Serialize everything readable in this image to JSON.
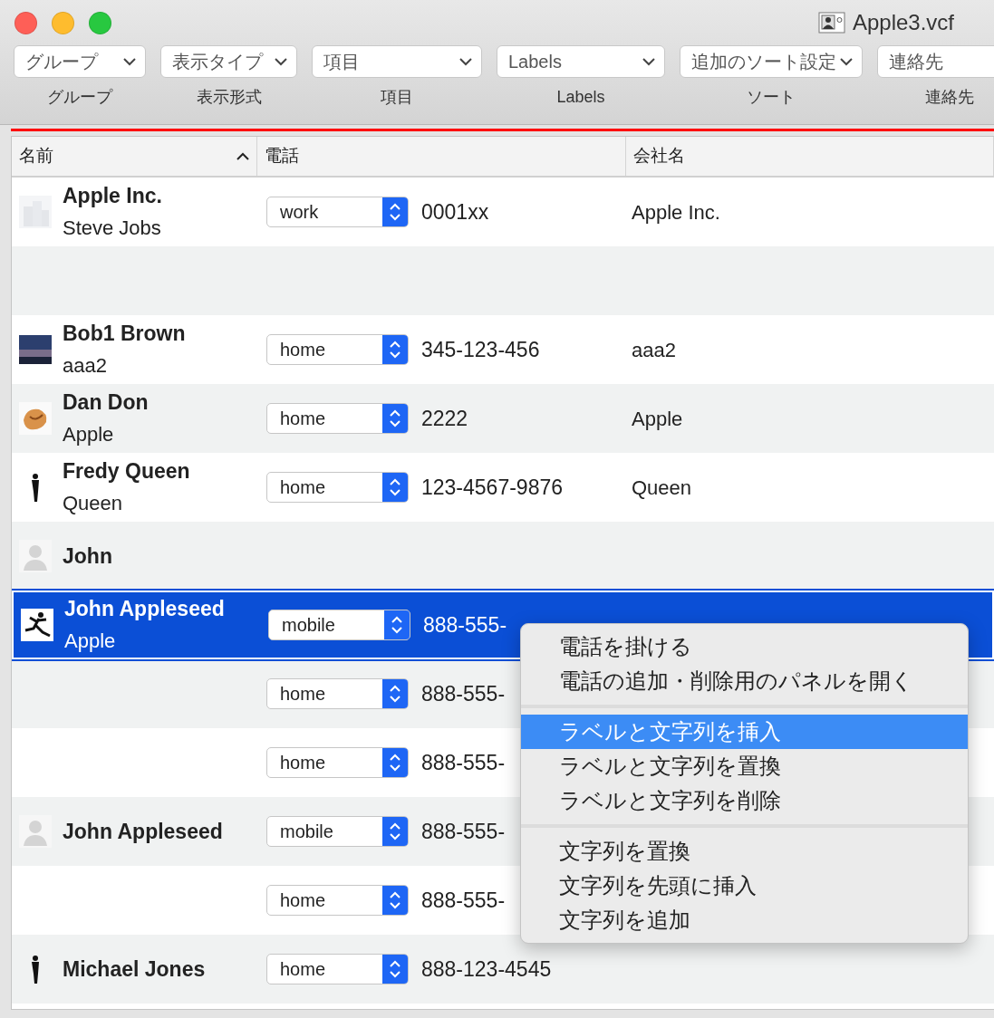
{
  "window": {
    "title": "Apple3.vcf"
  },
  "toolbar": [
    {
      "value": "グループ",
      "label": "グループ"
    },
    {
      "value": "表示タイプ",
      "label": "表示形式"
    },
    {
      "value": "項目",
      "label": "項目"
    },
    {
      "value": "Labels",
      "label": "Labels"
    },
    {
      "value": "追加のソート設定",
      "label": "ソート"
    },
    {
      "value": "連絡先",
      "label": "連絡先"
    }
  ],
  "table": {
    "columns": [
      {
        "title": "名前",
        "sorted": true
      },
      {
        "title": "電話",
        "sorted": false
      },
      {
        "title": "会社名",
        "sorted": false
      }
    ],
    "rows": [
      {
        "kind": "building",
        "name": "Apple Inc.",
        "subtitle": "Steve Jobs",
        "phone_label": "work",
        "phone": "0001xx",
        "company": "Apple Inc.",
        "selected": false
      },
      {
        "kind": "blank",
        "selected": false
      },
      {
        "kind": "photo",
        "name": "Bob1 Brown",
        "subtitle": "aaa2",
        "phone_label": "home",
        "phone": "345-123-456",
        "company": "aaa2",
        "selected": false
      },
      {
        "kind": "cookie",
        "name": "Dan Don",
        "subtitle": "Apple",
        "phone_label": "home",
        "phone": "2222",
        "company": "Apple",
        "selected": false
      },
      {
        "kind": "standing",
        "name": "Fredy Queen",
        "subtitle": "Queen",
        "phone_label": "home",
        "phone": "123-4567-9876",
        "company": "Queen",
        "selected": false
      },
      {
        "kind": "person",
        "name": "John",
        "selected": false
      },
      {
        "kind": "jumping",
        "name": "John Appleseed",
        "subtitle": "Apple",
        "phone_label": "mobile",
        "phone": "888-555-",
        "selected": true
      },
      {
        "kind": "continuation",
        "phone_label": "home",
        "phone": "888-555-",
        "selected": false
      },
      {
        "kind": "continuation",
        "phone_label": "home",
        "phone": "888-555-",
        "selected": false
      },
      {
        "kind": "person",
        "name": "John Appleseed",
        "phone_label": "mobile",
        "phone": "888-555-",
        "selected": false
      },
      {
        "kind": "continuation",
        "phone_label": "home",
        "phone": "888-555-",
        "selected": false
      },
      {
        "kind": "standing",
        "name": "Michael Jones",
        "phone_label": "home",
        "phone": "888-123-4545",
        "selected": false
      }
    ]
  },
  "context_menu": {
    "sections": [
      [
        {
          "label": "電話を掛ける",
          "selected": false
        },
        {
          "label": "電話の追加・削除用のパネルを開く",
          "selected": false
        }
      ],
      [
        {
          "label": "ラベルと文字列を挿入",
          "selected": true
        },
        {
          "label": "ラベルと文字列を置換",
          "selected": false
        },
        {
          "label": "ラベルと文字列を削除",
          "selected": false
        }
      ],
      [
        {
          "label": "文字列を置換",
          "selected": false
        },
        {
          "label": "文字列を先頭に挿入",
          "selected": false
        },
        {
          "label": "文字列を追加",
          "selected": false
        }
      ]
    ]
  }
}
